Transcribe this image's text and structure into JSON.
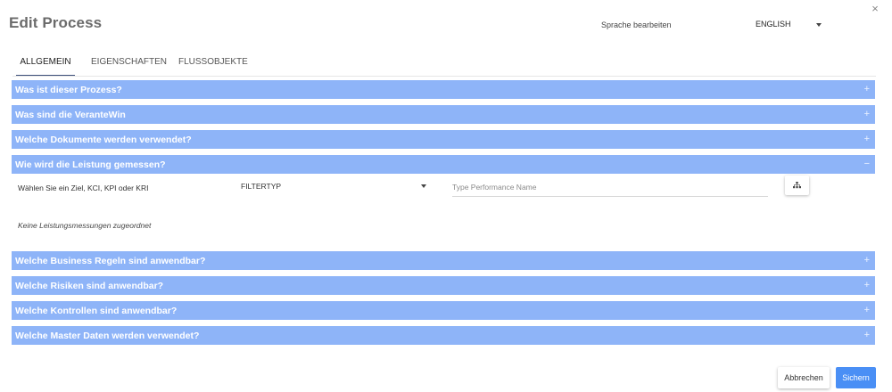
{
  "dialog": {
    "title": "Edit Process",
    "close_glyph": "×"
  },
  "language": {
    "label": "Sprache bearbeiten",
    "selected": "ENGLISH"
  },
  "tabs": [
    {
      "label": "ALLGEMEIN",
      "active": true
    },
    {
      "label": "EIGENSCHAFTEN",
      "active": false
    },
    {
      "label": "FLUSSOBJEKTE",
      "active": false
    }
  ],
  "accordion": [
    {
      "title": "Was ist dieser Prozess?",
      "toggle": "+"
    },
    {
      "title": "Was sind die VeranteWin",
      "toggle": "+"
    },
    {
      "title": "Welche Dokumente werden verwendet?",
      "toggle": "+"
    },
    {
      "title": "Wie wird die Leistung gemessen?",
      "toggle": "−"
    },
    {
      "title": "Welche Business Regeln sind anwendbar?",
      "toggle": "+"
    },
    {
      "title": "Welche Risiken sind anwendbar?",
      "toggle": "+"
    },
    {
      "title": "Welche Kontrollen sind anwendbar?",
      "toggle": "+"
    },
    {
      "title": "Welche Master Daten werden verwendet?",
      "toggle": "+"
    }
  ],
  "performance": {
    "select_label": "Wählen Sie ein Ziel, KCI, KPI oder KRI",
    "filter_value": "FILTERTYP",
    "search_placeholder": "Type Performance Name",
    "empty_message": "Keine Leistungsmessungen zugeordnet",
    "hierarchy_icon": "hierarchy-icon"
  },
  "actions": {
    "cancel_label": "Abbrechen",
    "save_label": "Sichern"
  },
  "colors": {
    "accordion_header": "#8eb4f8",
    "primary_button": "#4a8ff5",
    "tab_indicator": "#3d4f7a"
  }
}
